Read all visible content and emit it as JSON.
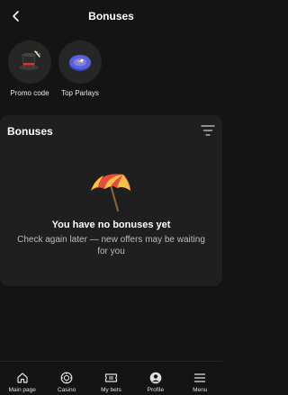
{
  "header": {
    "title": "Bonuses",
    "back_icon": "chevron-left-icon"
  },
  "quick_items": [
    {
      "label": "Promo code",
      "icon": "magic-hat-icon"
    },
    {
      "label": "Top Parlays",
      "icon": "parlay-chip-icon"
    }
  ],
  "bonuses_section": {
    "title": "Bonuses",
    "filter_icon": "filter-icon",
    "empty_icon": "beach-umbrella-icon",
    "empty_title": "You have no bonuses yet",
    "empty_description": "Check again later — new offers may be waiting for you"
  },
  "bottom_nav": [
    {
      "label": "Main page",
      "icon": "home-icon"
    },
    {
      "label": "Casino",
      "icon": "casino-chip-icon"
    },
    {
      "label": "My bets",
      "icon": "ticket-icon"
    },
    {
      "label": "Profile",
      "icon": "profile-icon"
    },
    {
      "label": "Menu",
      "icon": "menu-icon"
    }
  ],
  "colors": {
    "background": "#141414",
    "card": "#1f1f1f",
    "circle": "#262626",
    "text": "#ffffff",
    "muted_text": "#bdbdbd",
    "umbrella_red": "#e84a3c",
    "umbrella_yellow": "#f6c34a",
    "parlay_blue": "#5a5fe0"
  }
}
